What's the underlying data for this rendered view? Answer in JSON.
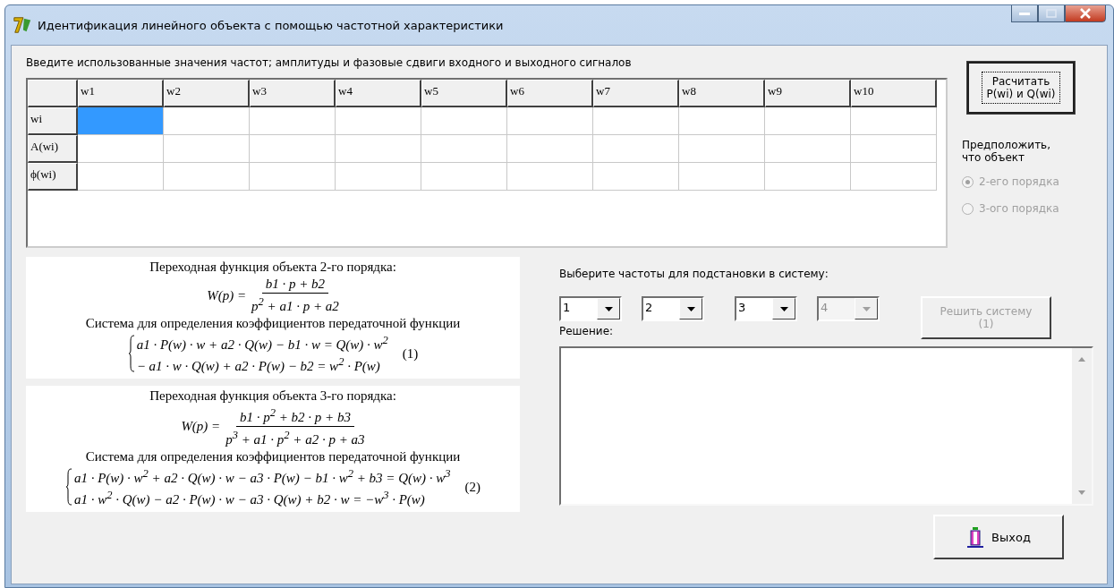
{
  "window": {
    "title": "Идентификация линейного объекта с помощью частотной характеристики"
  },
  "prompt": "Введите использованные значения частот; амплитуды и фазовые сдвиги входного и выходного сигналов",
  "table": {
    "columns": [
      "w1",
      "w2",
      "w3",
      "w4",
      "w5",
      "w6",
      "w7",
      "w8",
      "w9",
      "w10"
    ],
    "rows": [
      {
        "header": "wi",
        "cells": [
          {
            "selected": true
          },
          {
            "selected": false
          },
          {
            "selected": false
          },
          {
            "selected": false
          },
          {
            "selected": false
          },
          {
            "selected": false
          },
          {
            "selected": false
          },
          {
            "selected": false
          },
          {
            "selected": false
          },
          {
            "selected": false
          }
        ]
      },
      {
        "header": "A(wi)",
        "cells": [
          {
            "selected": false
          },
          {
            "selected": false
          },
          {
            "selected": false
          },
          {
            "selected": false
          },
          {
            "selected": false
          },
          {
            "selected": false
          },
          {
            "selected": false
          },
          {
            "selected": false
          },
          {
            "selected": false
          },
          {
            "selected": false
          }
        ]
      },
      {
        "header": "ϕ(wi)",
        "cells": [
          {
            "selected": false
          },
          {
            "selected": false
          },
          {
            "selected": false
          },
          {
            "selected": false
          },
          {
            "selected": false
          },
          {
            "selected": false
          },
          {
            "selected": false
          },
          {
            "selected": false
          },
          {
            "selected": false
          },
          {
            "selected": false
          }
        ]
      }
    ]
  },
  "calc_button": {
    "lines": [
      "Расчитать",
      "P(wi) и Q(wi)"
    ]
  },
  "assume": {
    "label": "Предположить, что объект",
    "options": [
      {
        "label": "2-его порядка",
        "selected": true,
        "disabled": true
      },
      {
        "label": "3-ого порядка",
        "selected": false,
        "disabled": true
      }
    ]
  },
  "formulas": [
    {
      "title": "Переходная функция объекта 2-го порядка:",
      "lhs": "W(p) =",
      "numerator": "b1 · p + b2",
      "denominator": "p$^{2}$ + a1 · p + a2",
      "system_title": "Система для определения коэффициентов передаточной функции",
      "equations": [
        "a1 · P(w) · w + a2 · Q(w) − b1 · w = Q(w) · w$^{2}$",
        "− a1 · w · Q(w) + a2 · P(w) − b2 = w$^{2}$ · P(w)"
      ],
      "number": "(1)"
    },
    {
      "title": "Переходная функция объекта 3-го порядка:",
      "lhs": "W(p) =",
      "numerator": "b1 · p$^{2}$ + b2 · p + b3",
      "denominator": "p$^{3}$ + a1 · p$^{2}$ + a2 · p + a3",
      "system_title": "Система для определения коэффициентов передаточной функции",
      "equations": [
        "a1 · P(w) · w$^{2}$ + a2 · Q(w) · w − a3 · P(w) − b1 · w$^{2}$ + b3 = Q(w) · w$^{3}$",
        "a1 · w$^{2}$ · Q(w) − a2 · P(w) · w − a3 · Q(w) + b2 · w = −w$^{3}$ · P(w)"
      ],
      "number": "(2)"
    }
  ],
  "freq_label": "Выберите частоты для подстановки в систему:",
  "combos": [
    {
      "value": "1",
      "disabled": false
    },
    {
      "value": "2",
      "disabled": false
    },
    {
      "value": "3",
      "disabled": false
    },
    {
      "value": "4",
      "disabled": true
    }
  ],
  "solve_button": {
    "lines": [
      "Решить систему",
      "(1)"
    ],
    "disabled": true
  },
  "solution_label": "Решение:",
  "exit_button": {
    "label": "Выход"
  }
}
